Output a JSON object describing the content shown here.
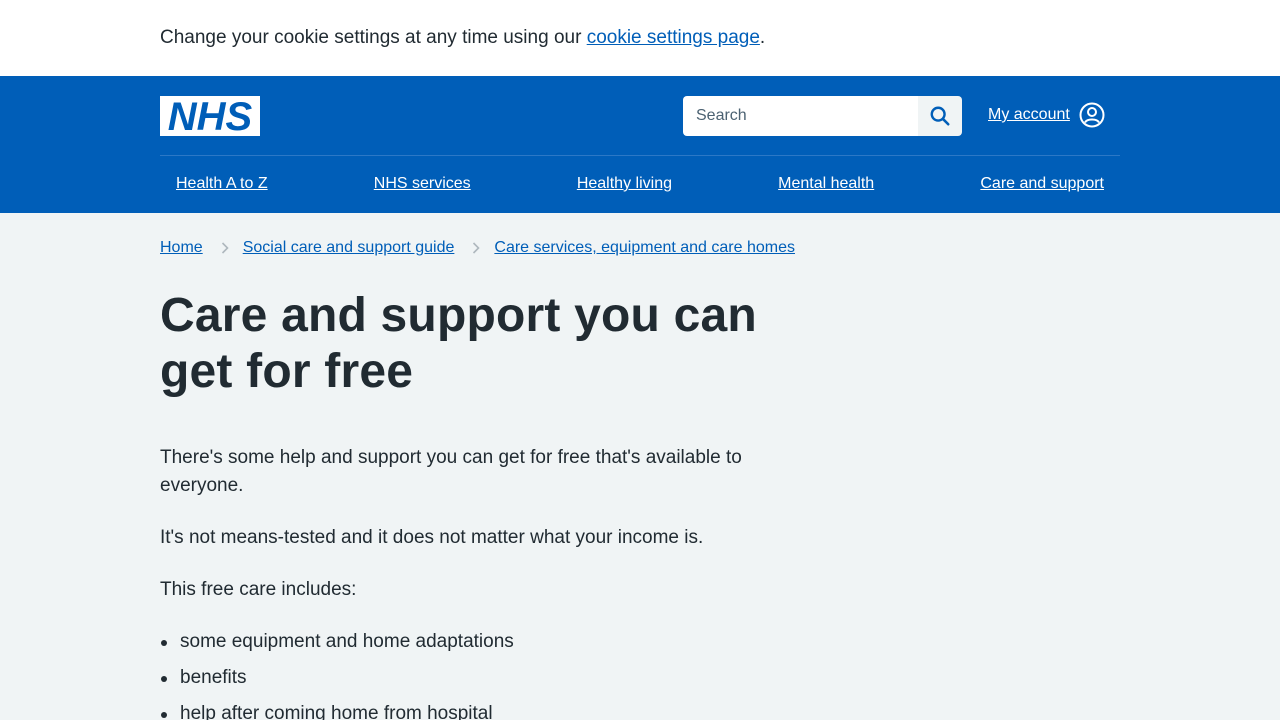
{
  "cookie_banner": {
    "text": "Change your cookie settings at any time using our ",
    "link": "cookie settings page",
    "trailing": "."
  },
  "header": {
    "logo_text": "NHS",
    "search": {
      "placeholder": "Search"
    },
    "account_label": "My account"
  },
  "nav": [
    {
      "label": "Health A to Z"
    },
    {
      "label": "NHS services"
    },
    {
      "label": "Healthy living"
    },
    {
      "label": "Mental health"
    },
    {
      "label": "Care and support"
    }
  ],
  "breadcrumb": [
    {
      "label": "Home"
    },
    {
      "label": "Social care and support guide"
    },
    {
      "label": "Care services, equipment and care homes"
    }
  ],
  "page": {
    "title": "Care and support you can get for free",
    "paragraphs": [
      "There's some help and support you can get for free that's available to everyone.",
      "It's not means-tested and it does not matter what your income is.",
      "This free care includes:"
    ],
    "list": [
      "some equipment and home adaptations",
      "benefits",
      "help after coming home from hospital"
    ]
  },
  "colors": {
    "brand": "#005eb8",
    "background": "#f0f4f5",
    "text": "#212b32"
  },
  "icons": {
    "search": "search-icon",
    "account": "user-circle-icon",
    "breadcrumb_separator": "chevron-right-icon"
  }
}
